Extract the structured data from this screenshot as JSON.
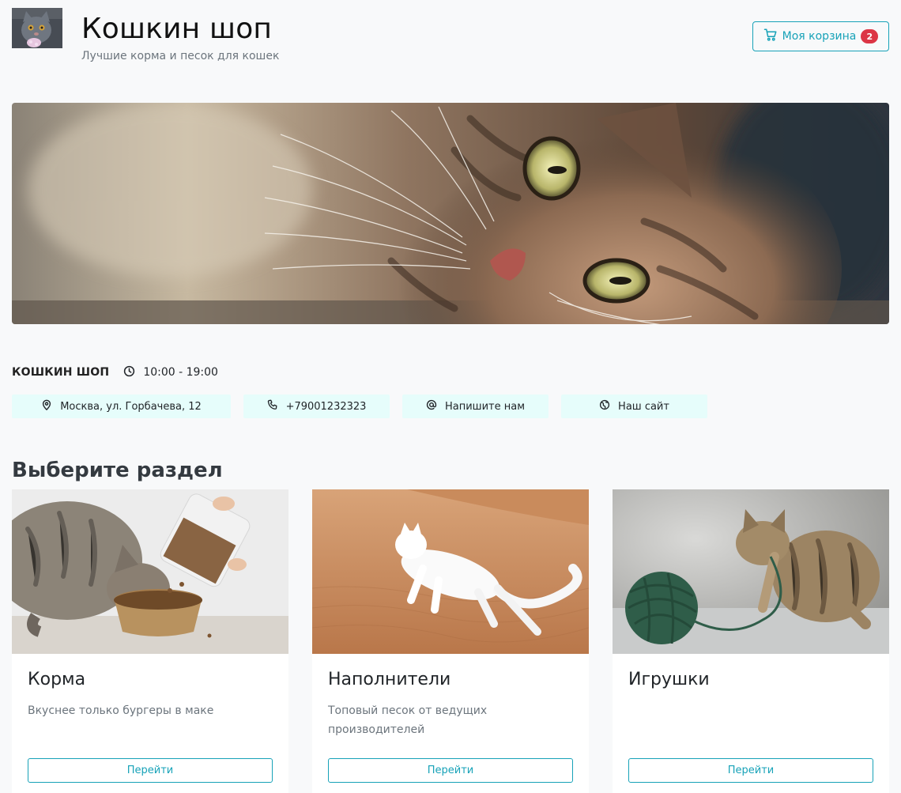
{
  "header": {
    "logo_alt": "cat-avatar",
    "title": "Кошкин шоп",
    "subtitle": "Лучшие корма и песок для кошек",
    "cart_label": "Моя корзина",
    "cart_count": "2",
    "cart_icon": "cart-icon"
  },
  "hero": {
    "image": "cat-closeup-photo"
  },
  "info": {
    "shop_name": "КОШКИН ШОП",
    "hours": "10:00 - 19:00",
    "contacts": [
      {
        "icon": "location-pin-icon",
        "label": "Москва, ул. Горбачева, 12"
      },
      {
        "icon": "phone-icon",
        "label": "+79001232323"
      },
      {
        "icon": "at-sign-icon",
        "label": "Напишите нам"
      },
      {
        "icon": "globe-icon",
        "label": "Наш сайт"
      }
    ]
  },
  "sections": {
    "title": "Выберите раздел",
    "cards": [
      {
        "title": "Корма",
        "text": "Вкуснее только бургеры в маке",
        "button": "Перейти",
        "image": "cat-eating-food-photo"
      },
      {
        "title": "Наполнители",
        "text": "Топовый песок от ведущих производителей",
        "button": "Перейти",
        "image": "white-cat-on-sand-photo"
      },
      {
        "title": "Игрушки",
        "text": "",
        "button": "Перейти",
        "image": "kitten-with-yarn-photo"
      }
    ]
  },
  "colors": {
    "accent": "#17a2b8",
    "badge": "#dc3545",
    "chip_bg": "#e6fdfb",
    "page_bg": "#f8f9fa"
  }
}
